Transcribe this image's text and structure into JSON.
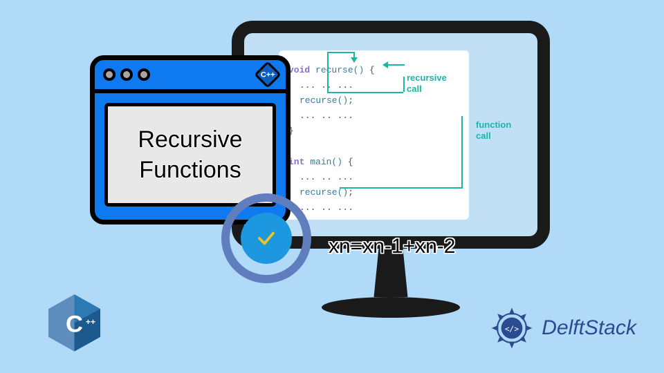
{
  "monitor": {
    "code": {
      "line1_kw": "void",
      "line1_fn": "recurse()",
      "line1_rest": " {",
      "line2": "... .. ...",
      "line3_fn": "recurse()",
      "line3_rest": ";",
      "line4": "... .. ...",
      "line5": "}",
      "line7_kw": "int",
      "line7_fn": "main()",
      "line7_rest": " {",
      "line8": "... .. ...",
      "line9_fn": "recurse()",
      "line9_rest": ";",
      "line10": "... .. ..."
    },
    "label_recursive": "recursive\ncall",
    "label_function": "function\ncall"
  },
  "window": {
    "title_line1": "Recursive",
    "title_line2": "Functions",
    "cpp_badge": "C++"
  },
  "formula": "xn=xn-1+xn-2",
  "cpp_logo_text": "C++",
  "delft_text": "DelftStack"
}
